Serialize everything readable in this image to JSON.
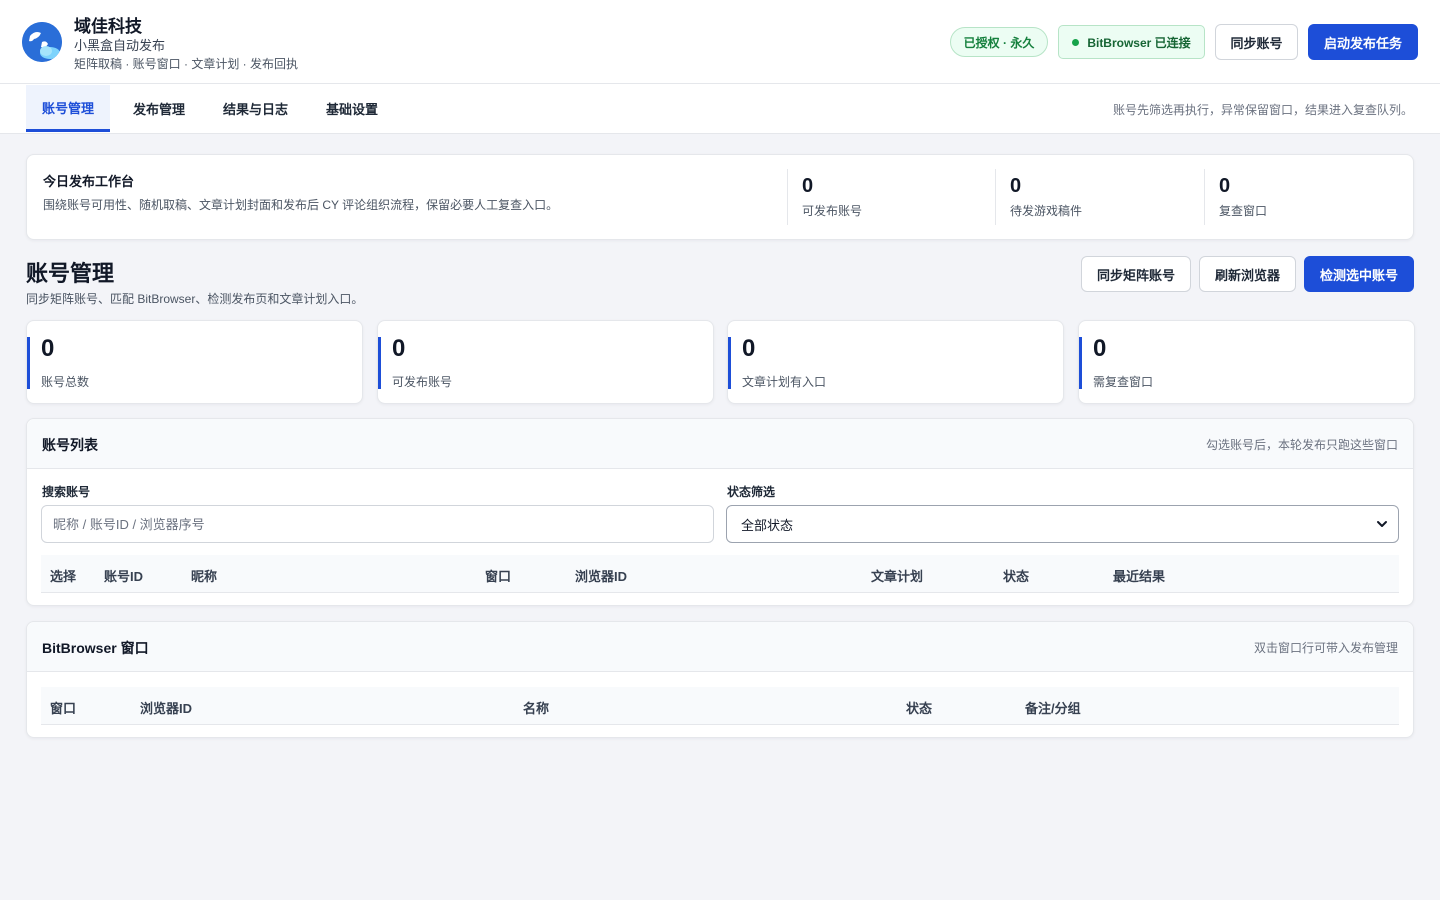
{
  "header": {
    "brand_title": "域佳科技",
    "brand_subtitle": "小黑盒自动发布",
    "brand_tagline": "矩阵取稿 · 账号窗口 · 文章计划 · 发布回执",
    "license_badge": "已授权 · 永久",
    "bitbrowser_status": "BitBrowser 已连接",
    "sync_button": "同步账号",
    "start_button": "启动发布任务"
  },
  "tabs": [
    {
      "label": "账号管理",
      "active": true
    },
    {
      "label": "发布管理",
      "active": false
    },
    {
      "label": "结果与日志",
      "active": false
    },
    {
      "label": "基础设置",
      "active": false
    }
  ],
  "tab_hint": "账号先筛选再执行，异常保留窗口，结果进入复查队列。",
  "workbench": {
    "title": "今日发布工作台",
    "description": "围绕账号可用性、随机取稿、文章计划封面和发布后 CY 评论组织流程，保留必要人工复查入口。",
    "stats": [
      {
        "value": "0",
        "label": "可发布账号"
      },
      {
        "value": "0",
        "label": "待发游戏稿件"
      },
      {
        "value": "0",
        "label": "复查窗口"
      }
    ]
  },
  "section": {
    "title": "账号管理",
    "description": "同步矩阵账号、匹配 BitBrowser、检测发布页和文章计划入口。",
    "buttons": {
      "sync": "同步矩阵账号",
      "refresh": "刷新浏览器",
      "detect": "检测选中账号"
    }
  },
  "stat_cards": [
    {
      "value": "0",
      "label": "账号总数"
    },
    {
      "value": "0",
      "label": "可发布账号"
    },
    {
      "value": "0",
      "label": "文章计划有入口"
    },
    {
      "value": "0",
      "label": "需复查窗口"
    }
  ],
  "accounts_panel": {
    "title": "账号列表",
    "hint": "勾选账号后，本轮发布只跑这些窗口",
    "search_label": "搜索账号",
    "search_placeholder": "昵称 / 账号ID / 浏览器序号",
    "search_value": "",
    "filter_label": "状态筛选",
    "filter_value": "全部状态",
    "columns": [
      "选择",
      "账号ID",
      "昵称",
      "窗口",
      "浏览器ID",
      "文章计划",
      "状态",
      "最近结果"
    ],
    "rows": []
  },
  "bitbrowser_panel": {
    "title": "BitBrowser 窗口",
    "hint": "双击窗口行可带入发布管理",
    "columns": [
      "窗口",
      "浏览器ID",
      "名称",
      "状态",
      "备注/分组"
    ],
    "rows": []
  },
  "colors": {
    "primary": "#1d4ed8",
    "success_bg": "#ecfdf3",
    "success_text": "#15803d",
    "page_bg": "#f3f4f8"
  }
}
